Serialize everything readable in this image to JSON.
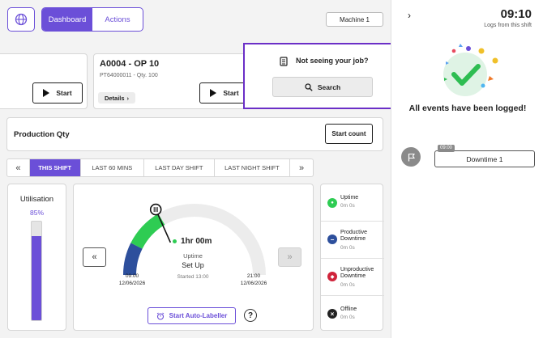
{
  "header": {
    "tabs": [
      {
        "label": "Dashboard",
        "active": true
      },
      {
        "label": "Actions",
        "active": false
      }
    ],
    "machine_label": "Machine 1"
  },
  "jobs": {
    "start_label": "Start",
    "cards": [
      {
        "title": "A0004 - OP 10",
        "subtitle": "PT64000011 - Qty. 100",
        "details_label": "Details"
      }
    ]
  },
  "not_seeing": {
    "text": "Not seeing your job?",
    "search_label": "Search"
  },
  "production": {
    "label": "Production Qty",
    "start_count_label": "Start count"
  },
  "shift_tabs": {
    "prev": "«",
    "next": "»",
    "items": [
      {
        "label": "THIS SHIFT",
        "active": true
      },
      {
        "label": "LAST 60 MINS",
        "active": false
      },
      {
        "label": "LAST DAY SHIFT",
        "active": false
      },
      {
        "label": "LAST NIGHT SHIFT",
        "active": false
      }
    ]
  },
  "utilisation": {
    "label": "Utilisation",
    "value_text": "85%",
    "value": 0.85
  },
  "gauge": {
    "duration": "1hr 00m",
    "state": "Uptime",
    "activity": "Set Up",
    "started": "Started 13:00",
    "start_time": "09:00",
    "start_date": "12/06/2026",
    "end_time": "21:00",
    "end_date": "12/06/2026",
    "prev": "«",
    "next": "»",
    "progress_fraction": 0.33,
    "colors": {
      "track": "#ececec",
      "downtime": "#2d4f9c",
      "uptime": "#2ecc53",
      "needle": "#111111"
    }
  },
  "legend": [
    {
      "name": "Uptime",
      "value": "0m 0s",
      "color": "#2ecc53",
      "glyph": "●"
    },
    {
      "name": "Productive Downtime",
      "value": "0m 0s",
      "color": "#2d4f9c",
      "glyph": "−"
    },
    {
      "name": "Unproductive Downtime",
      "value": "0m 0s",
      "color": "#d0243b",
      "glyph": "◆"
    },
    {
      "name": "Offline",
      "value": "0m 0s",
      "color": "#222222",
      "glyph": "×"
    }
  ],
  "auto_labeller": {
    "label": "Start Auto-Labeller",
    "help": "?"
  },
  "sidebar": {
    "time": "09:10",
    "subtitle": "Logs from this shift",
    "all_logged": "All events have been logged!",
    "events": [
      {
        "time": "09:00",
        "label": "Downtime 1"
      }
    ]
  },
  "colors": {
    "accent": "#6b4fd8",
    "highlight": "#6b2fc7"
  }
}
